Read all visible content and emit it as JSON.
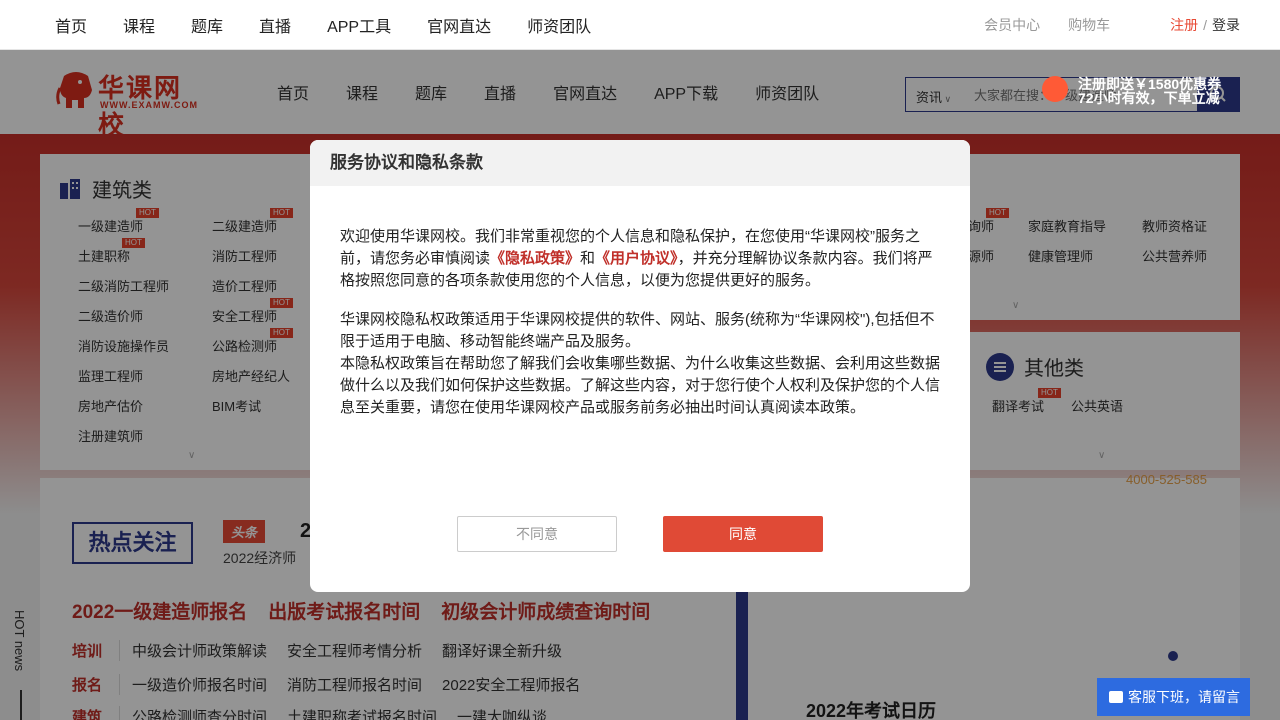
{
  "topbar": {
    "nav": [
      "首页",
      "课程",
      "题库",
      "直播",
      "APP工具",
      "官网直达",
      "师资团队"
    ],
    "member_center": "会员中心",
    "cart": "购物车",
    "register": "注册",
    "separator": "/",
    "login": "登录"
  },
  "header": {
    "logo_name": "华课网校",
    "logo_url": "WWW.EXAMW.COM",
    "nav": [
      "首页",
      "课程",
      "题库",
      "直播",
      "官网直达",
      "APP下载",
      "师资团队"
    ],
    "search": {
      "category": "资讯",
      "placeholder": "大家都在搜：一级建造师"
    },
    "promo_line1": "注册即送￥1580优惠券",
    "promo_line2": "72小时有效，下单立减"
  },
  "categories": {
    "building": {
      "title": "建筑类",
      "items": [
        "一级建造师",
        "二级建造师",
        "土建职称",
        "消防工程师",
        "二级消防工程师",
        "造价工程师",
        "二级造价师",
        "安全工程师",
        "消防设施操作员",
        "公路检测师",
        "监理工程师",
        "房地产经纪人",
        "房地产估价",
        "BIM考试",
        "注册建筑师"
      ],
      "hot_label": "HOT"
    },
    "right_items": [
      "询师",
      "家庭教育指导",
      "教师资格证",
      "源师",
      "健康管理师",
      "公共营养师"
    ],
    "other": {
      "title": "其他类",
      "items": [
        "翻译考试",
        "公共英语"
      ]
    }
  },
  "lower": {
    "hot_focus": "热点关注",
    "headline_tag": "头条",
    "headline_big": "2",
    "headline_sub": "2022经济师",
    "red_links": [
      "2022一级建造师报名",
      "出版考试报名时间",
      "初级会计师成绩查询时间"
    ],
    "rows": [
      {
        "label": "培训",
        "items": [
          "中级会计师政策解读",
          "安全工程师考情分析",
          "翻译好课全新升级"
        ]
      },
      {
        "label": "报名",
        "items": [
          "一级造价师报名时间",
          "消防工程师报名时间",
          "2022安全工程师报名"
        ]
      },
      {
        "label": "建筑",
        "items": [
          "公路检测师查分时间",
          "土建职称考试报名时间",
          "一建大咖纵谈"
        ]
      }
    ],
    "hot_news": "HOT news",
    "phone": "4000-525-585",
    "calendar_title": "2022年考试日历",
    "chat_label": "客服下班，请留言"
  },
  "modal": {
    "title": "服务协议和隐私条款",
    "p1_before": "欢迎使用华课网校。我们非常重视您的个人信息和隐私保护，在您使用“华课网校”服务之前，请您务必审慎阅读",
    "privacy_link": "《隐私政策》",
    "p1_and": "和",
    "terms_link": "《用户协议》",
    "p1_after": "，并充分理解协议条款内容。我们将严格按照您同意的各项条款使用您的个人信息，以便为您提供更好的服务。",
    "p2": "华课网校隐私权政策适用于华课网校提供的软件、网站、服务(统称为“华课网校\"),包括但不限于适用于电脑、移动智能终端产品及服务。",
    "p3": "本隐私权政策旨在帮助您了解我们会收集哪些数据、为什么收集这些数据、会利用这些数据做什么以及我们如何保护这些数据。了解这些内容，对于您行使个人权利及保护您的个人信息至关重要，请您在使用华课网校产品或服务前务必抽出时间认真阅读本政策。",
    "disagree": "不同意",
    "agree": "同意"
  },
  "colors": {
    "brand_red": "#d9301f",
    "navy": "#2d3a8c",
    "agree_button": "#e04a36",
    "chat_blue": "#2d6be0"
  }
}
